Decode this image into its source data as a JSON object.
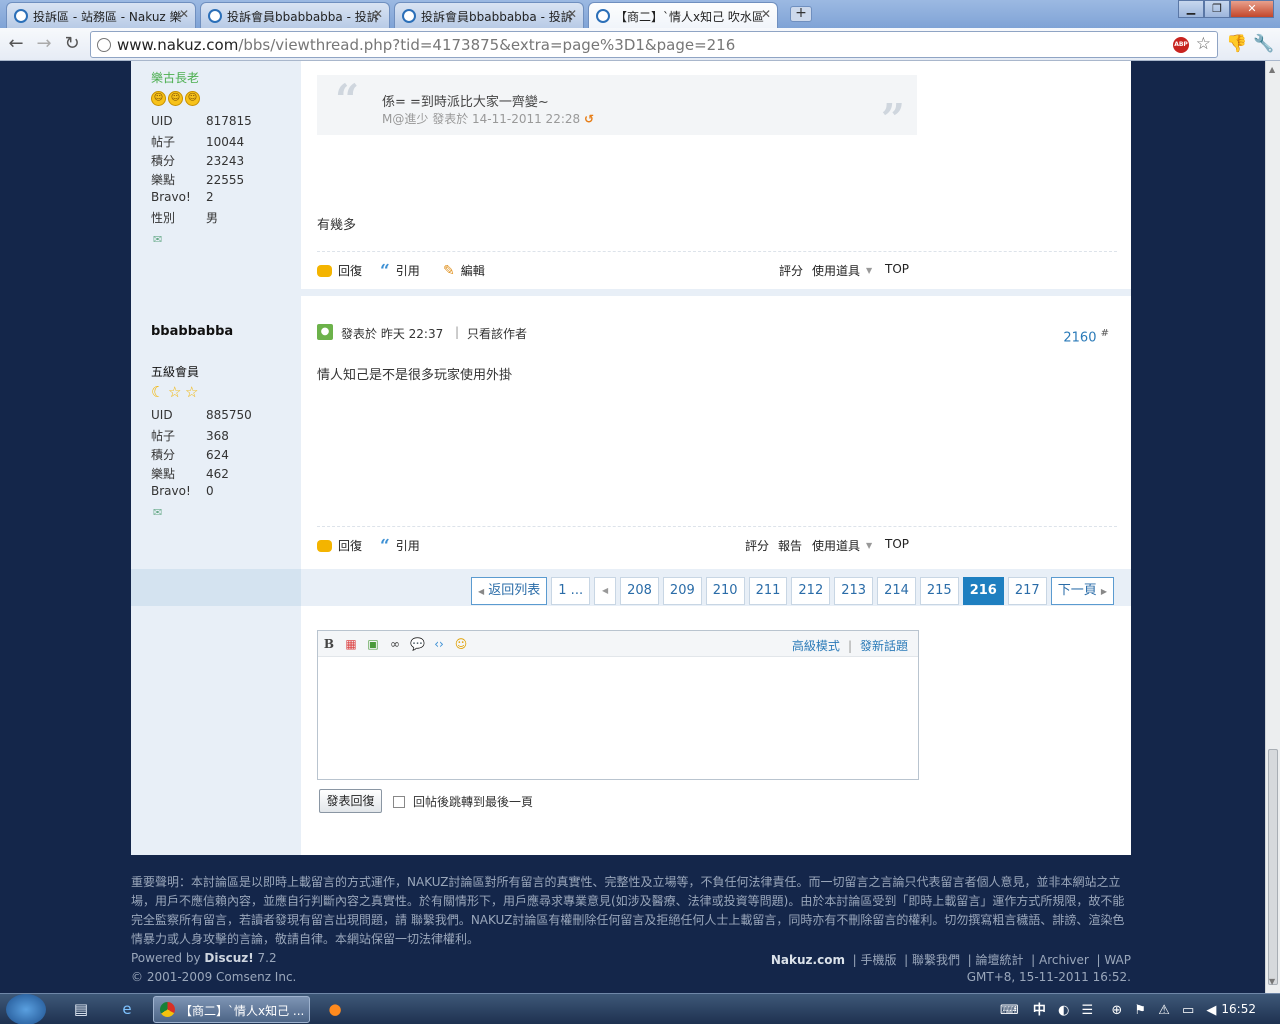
{
  "browser": {
    "tabs": [
      {
        "title": "投訴區 - 站務區 - Nakuz 樂"
      },
      {
        "title": "投訴會員bbabbabba - 投訴"
      },
      {
        "title": "投訴會員bbabbabba - 投訴"
      },
      {
        "title": "【商二】`情人x知己 吹水區"
      }
    ],
    "url_host": "www.nakuz.com",
    "url_path": "/bbs/viewthread.php?tid=4173875&extra=page%3D1&page=216",
    "abp_label": "ABP"
  },
  "post1": {
    "user_title": "樂古長老",
    "stats": [
      {
        "k": "UID",
        "v": "817815"
      },
      {
        "k": "帖子",
        "v": "10044"
      },
      {
        "k": "積分",
        "v": "23243"
      },
      {
        "k": "樂點",
        "v": "22555"
      },
      {
        "k": "Bravo!",
        "v": "2"
      },
      {
        "k": "性別",
        "v": "男"
      }
    ],
    "quote_text": "係= =到時派比大家一齊變~",
    "quote_author": "M@進少",
    "quote_meta": "發表於 14-11-2011 22:28",
    "message": "有幾多",
    "actions": {
      "reply": "回復",
      "quote": "引用",
      "edit": "編輯",
      "rate": "評分",
      "tools": "使用道具",
      "top": "TOP"
    }
  },
  "post2": {
    "username": "bbabbabba",
    "user_title": "五級會員",
    "stats": [
      {
        "k": "UID",
        "v": "885750"
      },
      {
        "k": "帖子",
        "v": "368"
      },
      {
        "k": "積分",
        "v": "624"
      },
      {
        "k": "樂點",
        "v": "462"
      },
      {
        "k": "Bravo!",
        "v": "0"
      }
    ],
    "posted": "發表於 昨天 22:37",
    "only_author": "只看該作者",
    "floor": "2160",
    "floor_mark": "#",
    "message": "情人知己是不是很多玩家使用外掛",
    "actions": {
      "reply": "回復",
      "quote": "引用",
      "rate": "評分",
      "report": "報告",
      "tools": "使用道具",
      "top": "TOP"
    }
  },
  "pager": {
    "back": "返回列表",
    "first": "1 ...",
    "pages": [
      "208",
      "209",
      "210",
      "211",
      "212",
      "213",
      "214",
      "215"
    ],
    "current": "216",
    "after": "217",
    "next": "下一頁"
  },
  "reply_box": {
    "advanced": "高級模式",
    "new_topic": "發新話題",
    "submit": "發表回復",
    "jump_label": "回帖後跳轉到最後一頁"
  },
  "footer": {
    "disclaimer": "重要聲明：本討論區是以即時上載留言的方式運作，NAKUZ討論區對所有留言的真實性、完整性及立場等，不負任何法律責任。而一切留言之言論只代表留言者個人意見，並非本網站之立場，用戶不應信賴內容，並應自行判斷內容之真實性。於有關情形下，用戶應尋求專業意見(如涉及醫療、法律或投資等問題)。由於本討論區受到「即時上載留言」運作方式所規限，故不能完全監察所有留言，若讀者發現有留言出現問題，請 聯繫我們。NAKUZ討論區有權刪除任何留言及拒絕任何人士上載留言，同時亦有不刪除留言的權利。切勿撰寫粗言穢語、誹謗、渲染色情暴力或人身攻擊的言論，敬請自律。本網站保留一切法律權利。",
    "powered_prefix": "Powered by ",
    "powered_name": "Discuz!",
    "powered_version": " 7.2",
    "copyright": "© 2001-2009 Comsenz Inc.",
    "site": "Nakuz.com",
    "links": [
      "手機版",
      "聯繫我們",
      "論壇統計",
      "Archiver",
      "WAP"
    ],
    "datetime": "GMT+8, 15-11-2011 16:52."
  },
  "taskbar": {
    "task_title": "【商二】`情人x知己 ...",
    "ime": "中",
    "clock": "16:52"
  }
}
